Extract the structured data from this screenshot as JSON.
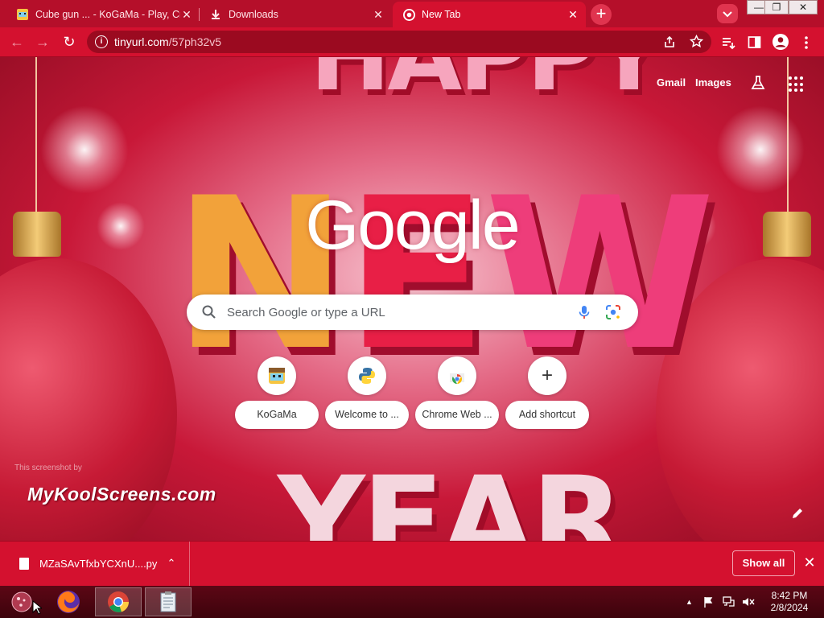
{
  "tabs": [
    {
      "title": "Cube gun ... - KoGaMa - Play, Cr",
      "close": "✕"
    },
    {
      "title": "Downloads",
      "close": "✕"
    },
    {
      "title": "New Tab",
      "close": "✕"
    }
  ],
  "new_tab_button": "+",
  "window_controls": {
    "minimize": "—",
    "maximize": "❐",
    "close": "✕"
  },
  "toolbar": {
    "url_host": "tinyurl.com",
    "url_path": "/57ph32v5",
    "back": "←",
    "forward": "→",
    "reload": "↻"
  },
  "ntp": {
    "gmail": "Gmail",
    "images": "Images",
    "logo": "Google",
    "search_placeholder": "Search Google or type a URL",
    "shortcuts": [
      {
        "label": "KoGaMa"
      },
      {
        "label": "Welcome to ..."
      },
      {
        "label": "Chrome Web ..."
      },
      {
        "label": "Add shortcut"
      }
    ],
    "add_glyph": "+",
    "background_art": {
      "top": "HAPPY",
      "middle_n": "N",
      "middle_e": "E",
      "middle_w": "W",
      "bottom": "YEAR"
    },
    "watermark_small": "This screenshot by",
    "watermark": "MyKoolScreens.com"
  },
  "download_shelf": {
    "file_name": "MZaSAvTfxbYCXnU....py",
    "chevron": "⌃",
    "show_all": "Show all",
    "close": "✕"
  },
  "taskbar": {
    "time": "8:42 PM",
    "date": "2/8/2024",
    "tray_arrow": "▲"
  },
  "colors": {
    "chrome_frame": "#b50f2a",
    "toolbar": "#d4112f",
    "omnibox": "#9b0a20",
    "taskbar": "#4a0510"
  }
}
